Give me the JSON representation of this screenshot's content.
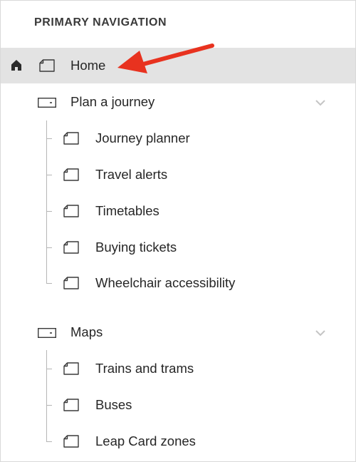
{
  "nav": {
    "heading": "PRIMARY NAVIGATION",
    "home": {
      "label": "Home",
      "home_icon": "home-icon",
      "page_icon": "page-icon"
    },
    "sections": [
      {
        "label": "Plan a journey",
        "icon": "folder-icon",
        "expand_icon": "chevron-down-icon",
        "items": [
          {
            "label": "Journey planner",
            "icon": "page-icon"
          },
          {
            "label": "Travel alerts",
            "icon": "page-icon"
          },
          {
            "label": "Timetables",
            "icon": "page-icon"
          },
          {
            "label": "Buying tickets",
            "icon": "page-icon"
          },
          {
            "label": "Wheelchair accessibility",
            "icon": "page-icon"
          }
        ]
      },
      {
        "label": "Maps",
        "icon": "folder-icon",
        "expand_icon": "chevron-down-icon",
        "items": [
          {
            "label": "Trains and trams",
            "icon": "page-icon"
          },
          {
            "label": "Buses",
            "icon": "page-icon"
          },
          {
            "label": "Leap Card zones",
            "icon": "page-icon"
          }
        ]
      }
    ]
  },
  "annotation": {
    "arrow_color": "#e8321f",
    "arrow_icon": "arrow-left-icon"
  },
  "colors": {
    "selected_row": "#e3e3e3",
    "text": "#262626",
    "tree_line": "#b5b5b5"
  }
}
